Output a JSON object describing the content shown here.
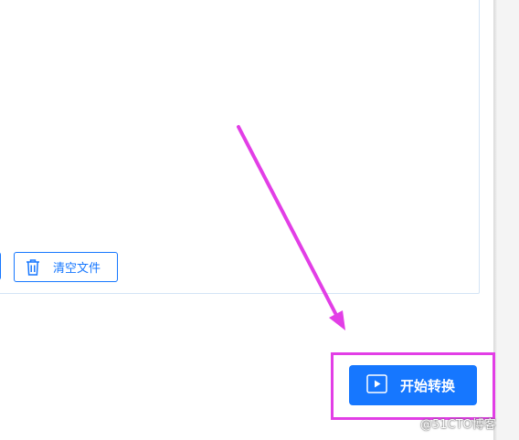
{
  "toolbar": {
    "clear_files_label": "清空文件",
    "clear_icon": "trash-icon"
  },
  "actions": {
    "start_convert_label": "开始转换",
    "start_icon": "play-icon"
  },
  "watermark": "@51CTO博客",
  "colors": {
    "accent": "#1677ff",
    "annotation": "#e23ee6",
    "dropzone_border": "#d3e4f5"
  }
}
